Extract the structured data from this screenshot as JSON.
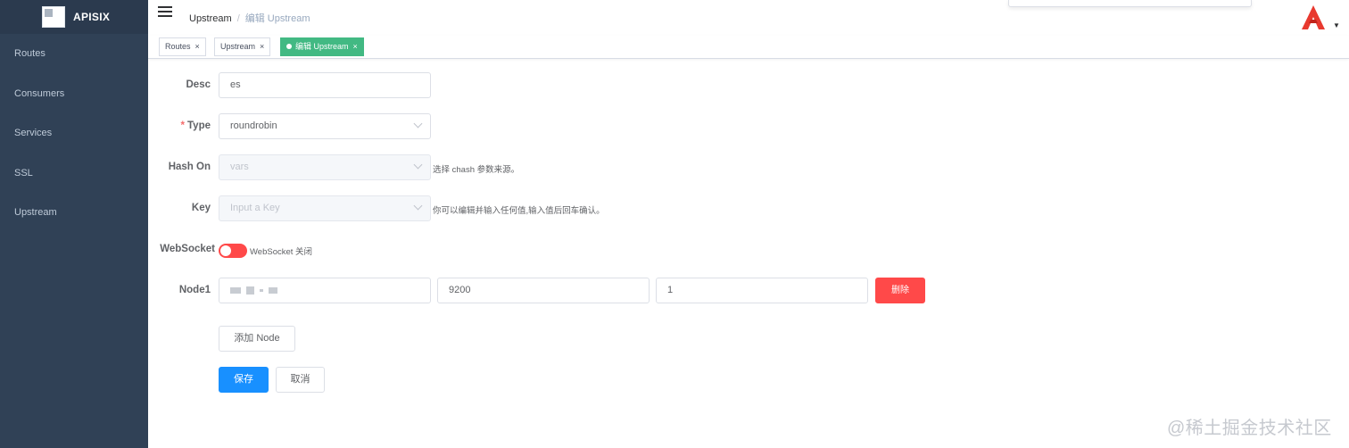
{
  "app": {
    "title": "APISIX"
  },
  "sidebar": {
    "items": [
      {
        "label": "Routes"
      },
      {
        "label": "Consumers"
      },
      {
        "label": "Services"
      },
      {
        "label": "SSL"
      },
      {
        "label": "Upstream"
      }
    ]
  },
  "breadcrumb": {
    "parent": "Upstream",
    "separator": "/",
    "current": "编辑 Upstream"
  },
  "tags": [
    {
      "label": "Routes",
      "close": "×"
    },
    {
      "label": "Upstream",
      "close": "×"
    },
    {
      "label": "编辑 Upstream",
      "close": "×"
    }
  ],
  "form": {
    "desc": {
      "label": "Desc",
      "value": "es"
    },
    "type": {
      "required_mark": "*",
      "label": "Type",
      "value": "roundrobin"
    },
    "hash_on": {
      "label": "Hash On",
      "placeholder": "vars",
      "hint": "选择 chash 参数来源。"
    },
    "key": {
      "label": "Key",
      "placeholder": "Input a Key",
      "hint": "你可以编辑并输入任何值,输入值后回车确认。"
    },
    "websocket": {
      "label": "WebSocket",
      "state_text": "WebSocket 关闭",
      "enabled": false
    },
    "node1": {
      "label": "Node1",
      "port": "9200",
      "weight": "1",
      "delete_label": "删除"
    },
    "add_node_label": "添加 Node",
    "save_label": "保存",
    "cancel_label": "取消"
  },
  "watermark": "@稀土掘金技术社区",
  "colors": {
    "sidebar": "#304156",
    "active_tag": "#42b983",
    "danger": "#ff4949",
    "primary": "#1890ff"
  }
}
